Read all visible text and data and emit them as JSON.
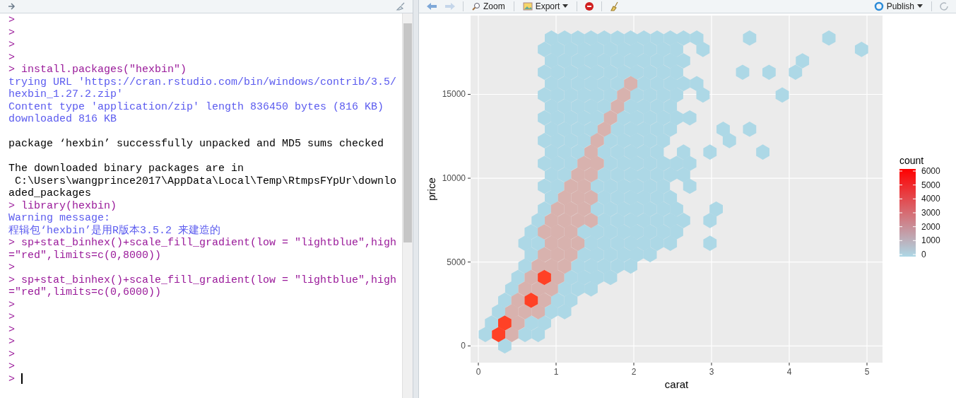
{
  "console": {
    "lines": [
      {
        "kind": "input",
        "text": ">"
      },
      {
        "kind": "input",
        "text": ">"
      },
      {
        "kind": "input",
        "text": ">"
      },
      {
        "kind": "input",
        "text": ">"
      },
      {
        "kind": "input",
        "text": "> install.packages(\"hexbin\")"
      },
      {
        "kind": "output",
        "text": "trying URL 'https://cran.rstudio.com/bin/windows/contrib/3.5/"
      },
      {
        "kind": "output",
        "text": "hexbin_1.27.2.zip'"
      },
      {
        "kind": "output",
        "text": "Content type 'application/zip' length 836450 bytes (816 KB)"
      },
      {
        "kind": "output",
        "text": "downloaded 816 KB"
      },
      {
        "kind": "blank"
      },
      {
        "kind": "message",
        "text": "package ‘hexbin’ successfully unpacked and MD5 sums checked"
      },
      {
        "kind": "blank"
      },
      {
        "kind": "message",
        "text": "The downloaded binary packages are in"
      },
      {
        "kind": "message",
        "text": " C:\\Users\\wangprince2017\\AppData\\Local\\Temp\\RtmpsFYpUr\\downlo"
      },
      {
        "kind": "message",
        "text": "aded_packages"
      },
      {
        "kind": "input",
        "text": "> library(hexbin)"
      },
      {
        "kind": "output",
        "text": "Warning message:"
      },
      {
        "kind": "output",
        "text": "程辑包‘hexbin’是用R版本3.5.2 来建造的"
      },
      {
        "kind": "input",
        "text": "> sp+stat_binhex()+scale_fill_gradient(low = \"lightblue\",high"
      },
      {
        "kind": "input",
        "text": "=\"red\",limits=c(0,8000))"
      },
      {
        "kind": "input",
        "text": ">"
      },
      {
        "kind": "input",
        "text": "> sp+stat_binhex()+scale_fill_gradient(low = \"lightblue\",high"
      },
      {
        "kind": "input",
        "text": "=\"red\",limits=c(0,6000))"
      },
      {
        "kind": "input",
        "text": ">"
      },
      {
        "kind": "input",
        "text": ">"
      },
      {
        "kind": "input",
        "text": ">"
      },
      {
        "kind": "input",
        "text": ">"
      },
      {
        "kind": "input",
        "text": ">"
      },
      {
        "kind": "input",
        "text": ">"
      },
      {
        "kind": "cursor",
        "text": ">"
      }
    ]
  },
  "plot_toolbar": {
    "zoom": "Zoom",
    "export": "Export",
    "publish": "Publish"
  },
  "plot": {
    "chart_data": {
      "type": "scatter",
      "xlabel": "carat",
      "ylabel": "price",
      "xlim": [
        -0.1,
        5.2
      ],
      "ylim": [
        -1000,
        19700
      ],
      "xticks": [
        0,
        1,
        2,
        3,
        4,
        5
      ],
      "yticks": [
        0,
        5000,
        10000,
        15000
      ],
      "grid": true,
      "series": [
        {
          "color": "#add8e6",
          "x": [
            0.34,
            0.09,
            0.6,
            0.77,
            0.17,
            0.68,
            0.85,
            0.26,
            0.94,
            1.11,
            0.34,
            1.02,
            1.19,
            0.43,
            1.11,
            1.28,
            1.45,
            0.51,
            1.19,
            1.36,
            1.53,
            1.7,
            0.6,
            1.28,
            1.45,
            1.62,
            1.79,
            1.96,
            0.68,
            1.36,
            1.53,
            1.7,
            1.87,
            2.04,
            2.21,
            0.6,
            0.77,
            1.45,
            1.62,
            1.79,
            1.96,
            2.13,
            2.3,
            2.47,
            2.98,
            0.68,
            1.36,
            1.53,
            1.7,
            1.87,
            2.04,
            2.21,
            2.38,
            2.55,
            0.77,
            1.62,
            1.79,
            1.96,
            2.13,
            2.3,
            2.47,
            2.64,
            2.98,
            0.85,
            1.53,
            1.7,
            1.87,
            2.04,
            2.21,
            2.38,
            2.55,
            3.06,
            0.94,
            1.62,
            1.79,
            1.96,
            2.13,
            2.3,
            2.47,
            0.85,
            1.02,
            1.53,
            1.7,
            1.87,
            2.04,
            2.21,
            2.38,
            2.72,
            0.94,
            1.11,
            1.62,
            1.79,
            1.96,
            2.13,
            2.3,
            2.47,
            2.64,
            0.85,
            1.02,
            1.19,
            1.7,
            1.87,
            2.04,
            2.21,
            2.38,
            2.55,
            2.72,
            0.94,
            1.11,
            1.28,
            1.62,
            1.79,
            1.96,
            2.13,
            2.3,
            2.64,
            2.98,
            3.66,
            0.85,
            1.02,
            1.19,
            1.36,
            1.7,
            1.87,
            2.04,
            2.21,
            2.38,
            3.23,
            0.94,
            1.11,
            1.28,
            1.45,
            1.79,
            1.96,
            2.13,
            2.3,
            2.47,
            3.15,
            3.49,
            0.85,
            1.02,
            1.19,
            1.36,
            1.53,
            1.87,
            2.04,
            2.21,
            2.38,
            2.55,
            2.72,
            0.94,
            1.11,
            1.28,
            1.45,
            1.62,
            1.96,
            2.13,
            2.3,
            2.47,
            0.85,
            1.02,
            1.19,
            1.36,
            1.53,
            1.7,
            2.04,
            2.21,
            2.38,
            2.55,
            2.89,
            3.91,
            0.94,
            1.11,
            1.28,
            1.45,
            1.62,
            1.79,
            2.13,
            2.3,
            2.47,
            2.64,
            2.81,
            0.85,
            1.02,
            1.19,
            1.36,
            1.53,
            1.7,
            1.87,
            2.04,
            2.21,
            2.38,
            2.55,
            3.4,
            3.74,
            4.08,
            0.94,
            1.11,
            1.28,
            1.45,
            1.62,
            1.79,
            1.96,
            2.13,
            2.3,
            2.47,
            2.64,
            4.17,
            0.85,
            1.02,
            1.19,
            1.36,
            1.53,
            1.7,
            1.87,
            2.04,
            2.21,
            2.38,
            2.55,
            2.89,
            4.93,
            0.94,
            1.11,
            1.28,
            1.45,
            1.62,
            1.79,
            1.96,
            2.13,
            2.3,
            2.47,
            2.64,
            2.81,
            3.49,
            4.51
          ],
          "values": [
            0,
            680,
            680,
            680,
            1360,
            1360,
            1360,
            2040,
            2040,
            2040,
            2720,
            2720,
            2720,
            3400,
            3400,
            3400,
            3400,
            4080,
            4080,
            4080,
            4080,
            4080,
            4760,
            4760,
            4760,
            4760,
            4760,
            4760,
            5440,
            5440,
            5440,
            5440,
            5440,
            5440,
            5440,
            6120,
            6120,
            6120,
            6120,
            6120,
            6120,
            6120,
            6120,
            6120,
            6120,
            6800,
            6800,
            6800,
            6800,
            6800,
            6800,
            6800,
            6800,
            6800,
            7480,
            7480,
            7480,
            7480,
            7480,
            7480,
            7480,
            7480,
            7480,
            8160,
            8160,
            8160,
            8160,
            8160,
            8160,
            8160,
            8160,
            8160,
            8840,
            8840,
            8840,
            8840,
            8840,
            8840,
            8840,
            9520,
            9520,
            9520,
            9520,
            9520,
            9520,
            9520,
            9520,
            9520,
            10200,
            10200,
            10200,
            10200,
            10200,
            10200,
            10200,
            10200,
            10200,
            10880,
            10880,
            10880,
            10880,
            10880,
            10880,
            10880,
            10880,
            10880,
            10880,
            11560,
            11560,
            11560,
            11560,
            11560,
            11560,
            11560,
            11560,
            11560,
            11560,
            11560,
            12240,
            12240,
            12240,
            12240,
            12240,
            12240,
            12240,
            12240,
            12240,
            12240,
            12920,
            12920,
            12920,
            12920,
            12920,
            12920,
            12920,
            12920,
            12920,
            12920,
            12920,
            13600,
            13600,
            13600,
            13600,
            13600,
            13600,
            13600,
            13600,
            13600,
            13600,
            13600,
            14280,
            14280,
            14280,
            14280,
            14280,
            14280,
            14280,
            14280,
            14280,
            14960,
            14960,
            14960,
            14960,
            14960,
            14960,
            14960,
            14960,
            14960,
            14960,
            14960,
            14960,
            15640,
            15640,
            15640,
            15640,
            15640,
            15640,
            15640,
            15640,
            15640,
            15640,
            15640,
            16320,
            16320,
            16320,
            16320,
            16320,
            16320,
            16320,
            16320,
            16320,
            16320,
            16320,
            16320,
            16320,
            16320,
            17000,
            17000,
            17000,
            17000,
            17000,
            17000,
            17000,
            17000,
            17000,
            17000,
            17000,
            17000,
            17680,
            17680,
            17680,
            17680,
            17680,
            17680,
            17680,
            17680,
            17680,
            17680,
            17680,
            17680,
            17680,
            18360,
            18360,
            18360,
            18360,
            18360,
            18360,
            18360,
            18360,
            18360,
            18360,
            18360,
            18360,
            18360,
            18360
          ]
        },
        {
          "color": "#d8b2ae",
          "x": [
            0.43,
            0.51,
            0.43,
            0.6,
            0.77,
            0.51,
            0.85,
            0.6,
            0.77,
            0.94,
            0.68,
            1.02,
            0.77,
            0.94,
            1.11,
            0.85,
            1.02,
            1.19,
            0.94,
            1.11,
            1.28,
            0.85,
            1.02,
            1.19,
            0.94,
            1.11,
            1.28,
            1.45,
            1.02,
            1.19,
            1.36,
            1.11,
            1.28,
            1.45,
            1.19,
            1.36,
            1.28,
            1.45,
            1.36,
            1.53,
            1.45,
            1.53,
            1.62,
            1.7,
            1.79,
            1.87,
            1.96
          ],
          "values": [
            680,
            1360,
            2040,
            2040,
            2040,
            2720,
            2720,
            3400,
            3400,
            3400,
            4080,
            4080,
            4760,
            4760,
            4760,
            5440,
            5440,
            5440,
            6120,
            6120,
            6120,
            6800,
            6800,
            6800,
            7480,
            7480,
            7480,
            7480,
            8160,
            8160,
            8160,
            8840,
            8840,
            8840,
            9520,
            9520,
            10200,
            10200,
            10880,
            10880,
            11560,
            12240,
            12920,
            13600,
            14280,
            14960,
            15640
          ]
        },
        {
          "color": "#ff4126",
          "x": [
            0.26,
            0.34,
            0.68,
            0.85
          ],
          "values": [
            680,
            1360,
            2720,
            4080
          ]
        }
      ]
    },
    "legend": {
      "title": "count",
      "labels": [
        "6000",
        "5000",
        "4000",
        "3000",
        "2000",
        "1000",
        "0"
      ]
    }
  }
}
